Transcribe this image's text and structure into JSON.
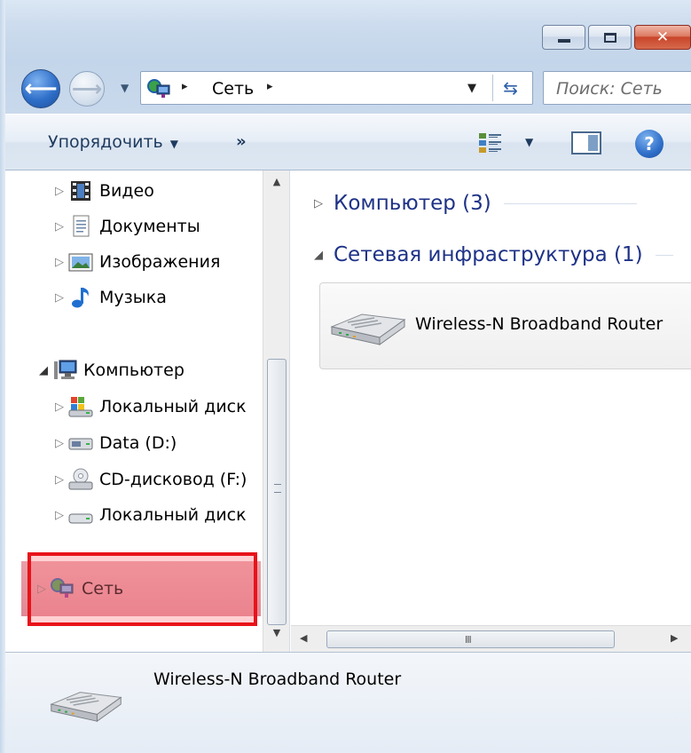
{
  "window": {
    "caption_buttons": {
      "minimize": "minimize",
      "maximize": "maximize",
      "close": "✕"
    }
  },
  "address_bar": {
    "separator": "▸",
    "location": "Сеть",
    "search_placeholder": "Поиск: Сеть"
  },
  "command_bar": {
    "organize_label": "Упорядочить",
    "more_label": "»"
  },
  "navigation_pane": {
    "items": [
      {
        "label": "Видео",
        "icon": "video-icon",
        "expander": "▷"
      },
      {
        "label": "Документы",
        "icon": "documents-icon",
        "expander": "▷"
      },
      {
        "label": "Изображения",
        "icon": "pictures-icon",
        "expander": "▷"
      },
      {
        "label": "Музыка",
        "icon": "music-icon",
        "expander": "▷"
      },
      {
        "label": "Компьютер",
        "icon": "computer-icon",
        "expander": "◢"
      },
      {
        "label": "Локальный диск",
        "icon": "windows-drive-icon",
        "expander": "▷"
      },
      {
        "label": "Data (D:)",
        "icon": "drive-icon",
        "expander": "▷"
      },
      {
        "label": "CD-дисковод (F:)",
        "icon": "cd-drive-icon",
        "expander": "▷"
      },
      {
        "label": "Локальный диск",
        "icon": "drive-icon",
        "expander": "▷"
      },
      {
        "label": "Сеть",
        "icon": "network-icon",
        "expander": "▷",
        "selected": true
      }
    ]
  },
  "content": {
    "groups": [
      {
        "label": "Компьютер (3)",
        "expander": "▷"
      },
      {
        "label": "Сетевая инфраструктура (1)",
        "expander": "◢"
      }
    ],
    "tiles": [
      {
        "label": "Wireless-N Broadband Router",
        "icon": "router-icon"
      }
    ]
  },
  "scroll": {
    "grip": "III"
  },
  "details_pane": {
    "title": "Wireless-N Broadband Router",
    "icon": "router-icon"
  },
  "colors": {
    "highlight_box": "#e8131a",
    "group_header": "#1e3287",
    "selection": "#df8a95"
  }
}
